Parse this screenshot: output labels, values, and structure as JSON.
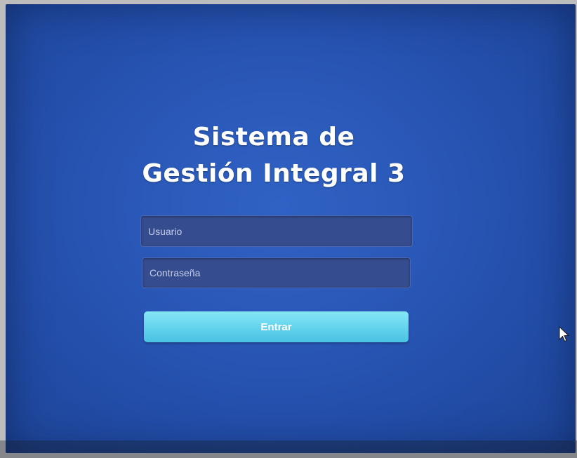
{
  "login": {
    "title_line1": "Sistema de",
    "title_line2": "Gestión Integral 3",
    "username_placeholder": "Usuario",
    "password_placeholder": "Contraseña",
    "submit_label": "Entrar"
  },
  "colors": {
    "background": "#2a58b8",
    "field": "#354c8e",
    "button": "#62d2ec",
    "text": "#ffffff"
  },
  "icons": {
    "pointer": "mouse-pointer-icon"
  }
}
